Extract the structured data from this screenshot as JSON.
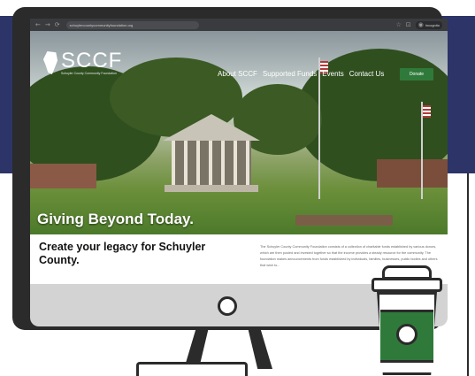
{
  "browser": {
    "controls": [
      "←",
      "→",
      "⟳"
    ],
    "url": "schuylercountycommunityfoundation.org",
    "icons": [
      "star-icon",
      "extension-icon"
    ],
    "profile_label": "Incognito"
  },
  "site": {
    "logo": {
      "wordmark": "SCCF",
      "tagline": "Schuyler County Community Foundation"
    },
    "nav": [
      "About SCCF",
      "Supported Funds",
      "Events",
      "Contact Us"
    ],
    "donate_label": "Donate",
    "hero_headline": "Giving Beyond Today.",
    "legacy_heading": "Create your legacy for Schuyler County.",
    "intro_text": "The Schuyler County Community Foundation consists of a collection of charitable funds established by various donors, which are then pooled and invested together so that the income provides a steady resource for the community. The foundation makes announcements from funds established by individuals, families, businesses, public bodies and others that wish to..."
  },
  "colors": {
    "navy_band": "#2c3468",
    "device_outline": "#2b2b2b",
    "monitor_chin": "#d3d3d3",
    "accent_green": "#2f7a3a"
  }
}
